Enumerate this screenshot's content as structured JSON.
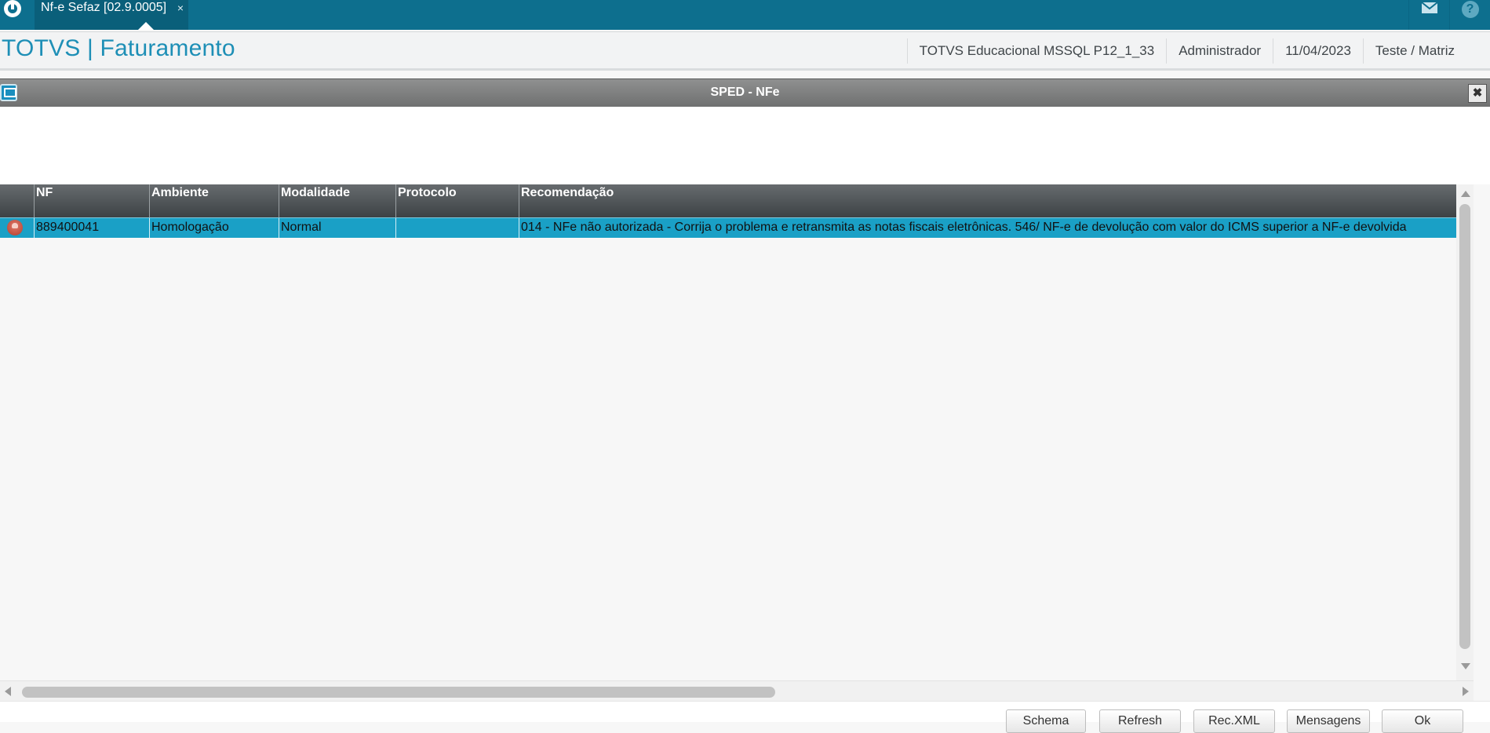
{
  "topbar": {
    "tab_label": "Nf-e Sefaz [02.9.0005]",
    "tab_close": "×",
    "help_label": "?"
  },
  "header": {
    "app_title": "TOTVS | Faturamento",
    "environment": "TOTVS Educacional MSSQL P12_1_33",
    "user": "Administrador",
    "date": "11/04/2023",
    "branch": "Teste / Matriz"
  },
  "dialog": {
    "title": "SPED - NFe",
    "close": "✖"
  },
  "grid": {
    "columns": [
      "",
      "NF",
      "Ambiente",
      "Modalidade",
      "Protocolo",
      "Recomendação"
    ],
    "rows": [
      {
        "status": "error-icon",
        "nf": "889400041",
        "ambiente": "Homologação",
        "modalidade": "Normal",
        "protocolo": "",
        "recomendacao": "014 - NFe não autorizada - Corrija o problema e retransmita as notas fiscais eletrônicas. 546/ NF-e de devolução com valor do ICMS superior a NF-e devolvida"
      }
    ]
  },
  "buttons": {
    "schema": "Schema",
    "refresh": "Refresh",
    "rec_xml": "Rec.XML",
    "mensagens": "Mensagens",
    "ok": "Ok"
  },
  "colors": {
    "topbar": "#0d6f8e",
    "title": "#1e8fb6",
    "selected_row": "#1aa0c6",
    "grid_header": "#4d5255"
  }
}
